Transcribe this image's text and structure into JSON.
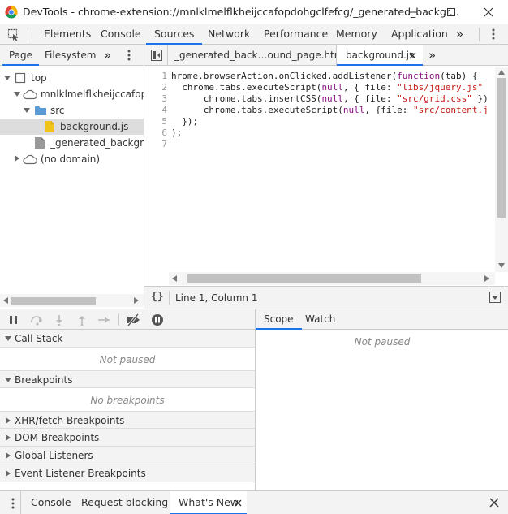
{
  "window": {
    "title": "DevTools - chrome-extension://mnlklmelflkheijccafopdohgclfefcg/_generated_backgr..."
  },
  "main_tabs": [
    "Elements",
    "Console",
    "Sources",
    "Network",
    "Performance",
    "Memory",
    "Application"
  ],
  "main_tabs_overflow": "»",
  "navigator": {
    "tabs": [
      "Page",
      "Filesystem"
    ],
    "overflow": "»",
    "tree": [
      {
        "label": "top"
      },
      {
        "label": "mnlklmelflkheijccafopdohgclfefcg"
      },
      {
        "label": "src"
      },
      {
        "label": "background.js"
      },
      {
        "label": "_generated_background_page.html"
      },
      {
        "label": "(no domain)"
      }
    ]
  },
  "editor": {
    "tabs": [
      {
        "label": "_generated_back…ound_page.html"
      },
      {
        "label": "background.js"
      }
    ],
    "overflow": "»",
    "line_numbers": [
      "1",
      "2",
      "3",
      "4",
      "5",
      "6",
      "7"
    ],
    "code": [
      {
        "a": "hrome.browserAction.onClicked.addListener(",
        "kw": "function",
        "b": "(tab) {"
      },
      {
        "a": "  chrome.tabs.executeScript(",
        "kw": "null",
        "b": ", { file: ",
        "s": "\"libs/jquery.js\""
      },
      {
        "a": "      chrome.tabs.insertCSS(",
        "kw": "null",
        "b": ", { file: ",
        "s": "\"src/grid.css\"",
        "c": " })"
      },
      {
        "a": "      chrome.tabs.executeScript(",
        "kw": "null",
        "b": ", {file: ",
        "s": "\"src/content.j"
      },
      {
        "a": "  });"
      },
      {
        "a": ");"
      },
      {
        "a": ""
      }
    ]
  },
  "status": {
    "format_icon": "{}",
    "position": "Line 1, Column 1"
  },
  "debugger": {
    "sections": [
      {
        "label": "Call Stack",
        "expanded": true,
        "empty": "Not paused"
      },
      {
        "label": "Breakpoints",
        "expanded": true,
        "empty": "No breakpoints"
      },
      {
        "label": "XHR/fetch Breakpoints",
        "expanded": false
      },
      {
        "label": "DOM Breakpoints",
        "expanded": false
      },
      {
        "label": "Global Listeners",
        "expanded": false
      },
      {
        "label": "Event Listener Breakpoints",
        "expanded": false
      }
    ],
    "scope_tabs": [
      "Scope",
      "Watch"
    ],
    "scope_empty": "Not paused"
  },
  "drawer": {
    "tabs": [
      "Console",
      "Request blocking",
      "What's New"
    ]
  },
  "colors": {
    "accent": "#1a73e8",
    "folder": "#5b9bd5",
    "file": "#f0c419",
    "keyword": "#881280",
    "string": "#c41a16"
  }
}
